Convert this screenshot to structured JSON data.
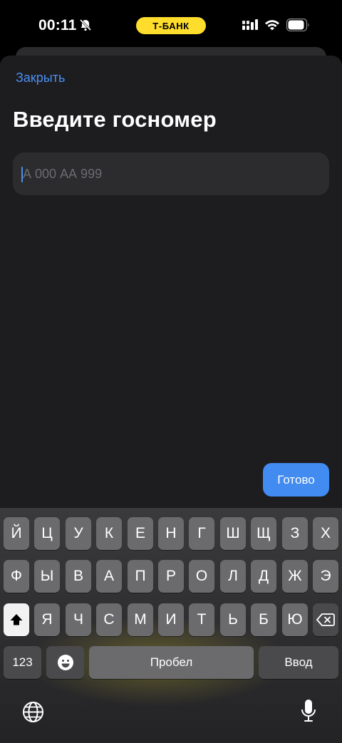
{
  "status_bar": {
    "time": "00:11",
    "carrier_badge": "Т-БАНК",
    "badge_color": "#ffdd2d",
    "icons": [
      "bell-slash-icon",
      "signal-icon",
      "wifi-icon",
      "battery-icon"
    ]
  },
  "sheet": {
    "close_label": "Закрыть",
    "title": "Введите госномер",
    "plate_input": {
      "value": "",
      "placeholder": "А 000 АА 999"
    },
    "done_label": "Готово",
    "accent_color": "#428bf0"
  },
  "keyboard": {
    "row1": [
      "Й",
      "Ц",
      "У",
      "К",
      "Е",
      "Н",
      "Г",
      "Ш",
      "Щ",
      "З",
      "Х"
    ],
    "row2": [
      "Ф",
      "Ы",
      "В",
      "А",
      "П",
      "Р",
      "О",
      "Л",
      "Д",
      "Ж",
      "Э"
    ],
    "row3": [
      "Я",
      "Ч",
      "С",
      "М",
      "И",
      "Т",
      "Ь",
      "Б",
      "Ю"
    ],
    "numbers_label": "123",
    "space_label": "Пробел",
    "return_label": "Ввод",
    "icons": [
      "shift-icon",
      "backspace-icon",
      "emoji-icon",
      "globe-icon",
      "microphone-icon"
    ]
  }
}
